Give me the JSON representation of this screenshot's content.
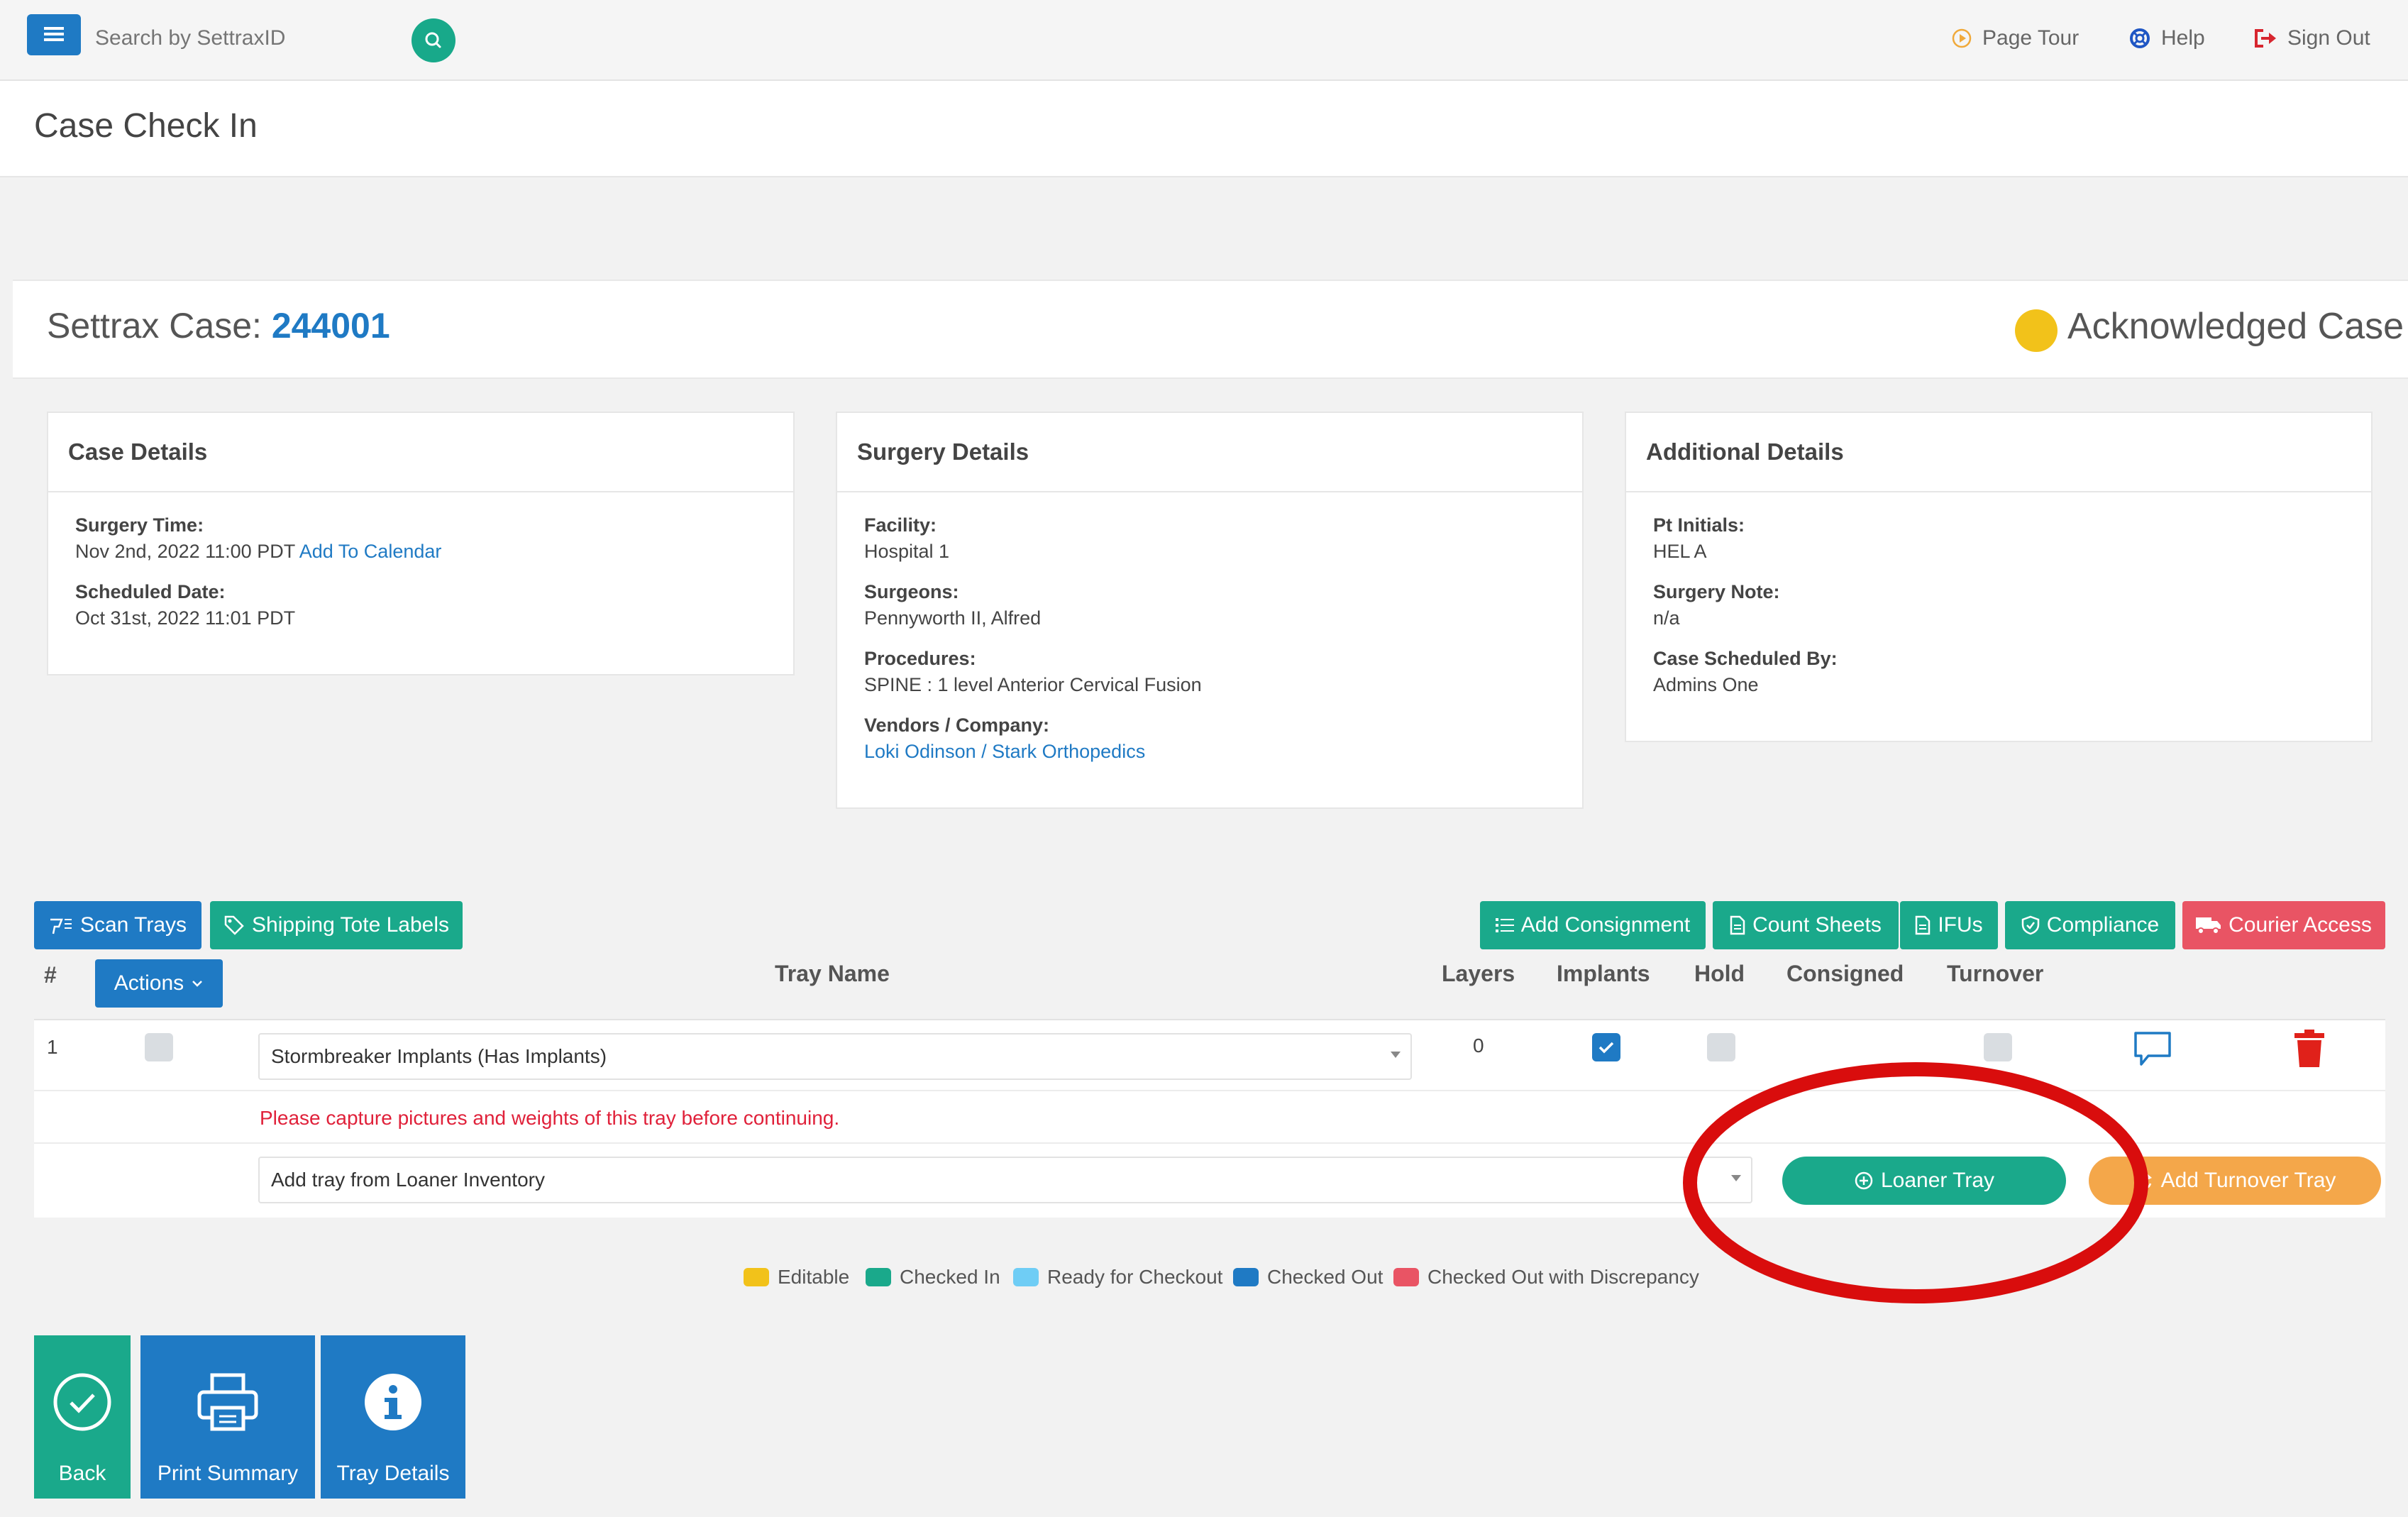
{
  "topbar": {
    "search_placeholder": "Search by SettraxID",
    "page_tour": "Page Tour",
    "help": "Help",
    "sign_out": "Sign Out"
  },
  "page": {
    "title": "Case Check In"
  },
  "case": {
    "prefix": "Settrax Case:",
    "id": "244001",
    "status": "Acknowledged Case",
    "status_color": "#f2c21a"
  },
  "case_details": {
    "title": "Case Details",
    "surgery_time_label": "Surgery Time:",
    "surgery_time": "Nov 2nd, 2022 11:00 PDT",
    "add_to_calendar": "Add To Calendar",
    "scheduled_date_label": "Scheduled Date:",
    "scheduled_date": "Oct 31st, 2022 11:01 PDT"
  },
  "surgery_details": {
    "title": "Surgery Details",
    "facility_label": "Facility:",
    "facility": "Hospital 1",
    "surgeons_label": "Surgeons:",
    "surgeons": "Pennyworth II, Alfred",
    "procedures_label": "Procedures:",
    "procedures": "SPINE : 1 level Anterior Cervical Fusion",
    "vendors_label": "Vendors / Company:",
    "vendors": "Loki Odinson / Stark Orthopedics"
  },
  "additional_details": {
    "title": "Additional Details",
    "pt_initials_label": "Pt Initials:",
    "pt_initials": "HEL A",
    "surgery_note_label": "Surgery Note:",
    "surgery_note": "n/a",
    "scheduled_by_label": "Case Scheduled By:",
    "scheduled_by": "Admins One"
  },
  "toolbar": {
    "scan_trays": "Scan Trays",
    "shipping_tote_labels": "Shipping Tote Labels",
    "add_consignment": "Add Consignment",
    "count_sheets": "Count Sheets",
    "ifus": "IFUs",
    "compliance": "Compliance",
    "courier_access": "Courier Access"
  },
  "table": {
    "headers": {
      "num": "#",
      "actions": "Actions",
      "tray_name": "Tray Name",
      "layers": "Layers",
      "implants": "Implants",
      "hold": "Hold",
      "consigned": "Consigned",
      "turnover": "Turnover"
    },
    "rows": [
      {
        "num": "1",
        "tray_name": "Stormbreaker Implants (Has Implants)",
        "layers": "0",
        "implants": true,
        "hold": false,
        "turnover": false
      }
    ],
    "warning": "Please capture pictures and weights of this tray before continuing.",
    "loaner_select": "Add tray from Loaner Inventory",
    "loaner_tray_button": "Loaner Tray",
    "add_turnover_tray_button": "Add Turnover Tray"
  },
  "legend": [
    {
      "label": "Editable",
      "color": "#f2c21a"
    },
    {
      "label": "Checked In",
      "color": "#1aa98b"
    },
    {
      "label": "Ready for Checkout",
      "color": "#6fcdf5"
    },
    {
      "label": "Checked Out",
      "color": "#1f7ac4"
    },
    {
      "label": "Checked Out with Discrepancy",
      "color": "#e95464"
    }
  ],
  "bottom": {
    "back": "Back",
    "print_summary": "Print Summary",
    "tray_details": "Tray Details"
  }
}
